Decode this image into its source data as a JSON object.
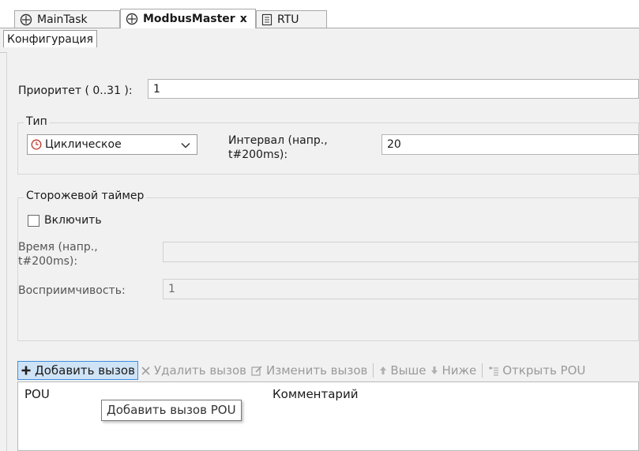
{
  "tabs": [
    {
      "label": "MainTask",
      "icon": "task-icon"
    },
    {
      "label": "ModbusMaster",
      "icon": "task-icon",
      "close": "x"
    },
    {
      "label": "RTU",
      "icon": "document-icon"
    }
  ],
  "subtab": {
    "label": "Конфигурация"
  },
  "priority": {
    "label": "Приоритет ( 0..31 ):",
    "value": "1"
  },
  "type_group": {
    "legend": "Тип",
    "select_value": "Циклическое",
    "interval_label_1": "Интервал (напр.,",
    "interval_label_2": "t#200ms):",
    "interval_value": "20"
  },
  "watchdog": {
    "legend": "Сторожевой таймер",
    "enable_label": "Включить",
    "enable_checked": false,
    "time_label_1": "Время (напр.,",
    "time_label_2": "t#200ms):",
    "time_value": "",
    "sensitivity_label": "Восприимчивость:",
    "sensitivity_value": "1"
  },
  "toolbar": {
    "add": "Добавить вызов",
    "remove": "Удалить вызов",
    "edit": "Изменить вызов",
    "up": "Выше",
    "down": "Ниже",
    "open": "Открыть POU"
  },
  "table": {
    "col_pou": "POU",
    "col_comment": "Комментарий"
  },
  "tooltip": "Добавить вызов POU",
  "colors": {
    "accent": "#3c8ee0",
    "active_bg": "#cfe3f6"
  }
}
